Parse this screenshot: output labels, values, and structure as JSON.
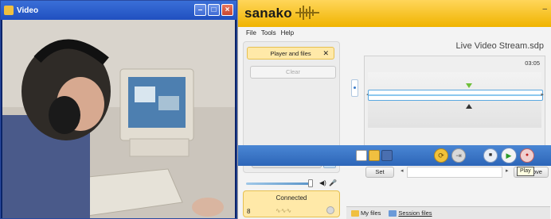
{
  "video_window": {
    "title": "Video"
  },
  "app": {
    "brand": "sanako",
    "menu": [
      "File",
      "Tools",
      "Help"
    ],
    "player_files": {
      "label": "Player and files",
      "close": "✕"
    },
    "clear_label": "Clear",
    "call_label": "Call",
    "status": {
      "text": "Connected",
      "count": "8"
    },
    "stream_title": "Live Video Stream.sdp",
    "time": "03:05",
    "set_label": "Set",
    "remove_label": "Remove",
    "tooltip": "Play",
    "tabs": [
      "My files",
      "Session files"
    ]
  },
  "colors": {
    "header": "#f0b400",
    "toolbar": "#2d66b8",
    "accent": "#ffe9a8"
  }
}
